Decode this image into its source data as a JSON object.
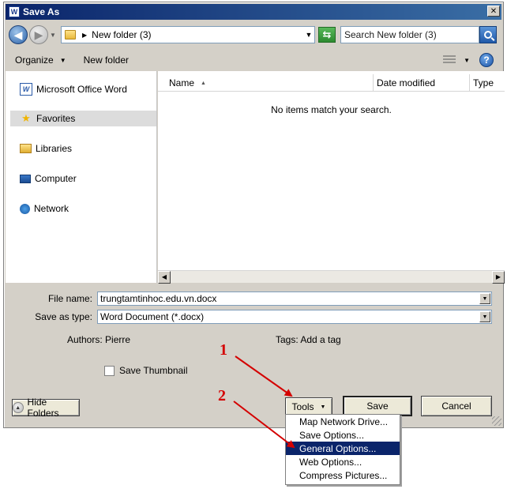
{
  "window": {
    "title": "Save As",
    "app_icon_letter": "W",
    "close_symbol": "✕"
  },
  "address": {
    "path_text": "New folder (3)",
    "search_text": "Search New folder (3)"
  },
  "toolbar": {
    "organize_label": "Organize",
    "new_folder_label": "New folder",
    "help_symbol": "?"
  },
  "nav": {
    "items": [
      {
        "label": "Microsoft Office Word",
        "icon": "word-icon",
        "selected": false
      },
      {
        "label": "Favorites",
        "icon": "star-icon",
        "selected": true
      },
      {
        "label": "Libraries",
        "icon": "libraries-icon",
        "selected": false
      },
      {
        "label": "Computer",
        "icon": "computer-icon",
        "selected": false
      },
      {
        "label": "Network",
        "icon": "network-icon",
        "selected": false
      }
    ]
  },
  "columns": [
    "Name",
    "Date modified",
    "Type"
  ],
  "empty_message": "No items match your search.",
  "form": {
    "file_name_label": "File name:",
    "file_name_value": "trungtamtinhoc.edu.vn.docx",
    "save_type_label": "Save as type:",
    "save_type_value": "Word Document (*.docx)",
    "authors_label": "Authors:",
    "authors_value": "Pierre",
    "tags_label": "Tags:",
    "tags_value": "Add a tag",
    "thumbnail_label": "Save Thumbnail"
  },
  "buttons": {
    "hide_folders": "Hide Folders",
    "tools": "Tools",
    "save": "Save",
    "cancel": "Cancel"
  },
  "tools_menu": {
    "items": [
      "Map Network Drive...",
      "Save Options...",
      "General Options...",
      "Web Options...",
      "Compress Pictures..."
    ],
    "highlighted_index": 2
  },
  "annotations": {
    "first": "1",
    "second": "2",
    "color": "#d40000"
  }
}
